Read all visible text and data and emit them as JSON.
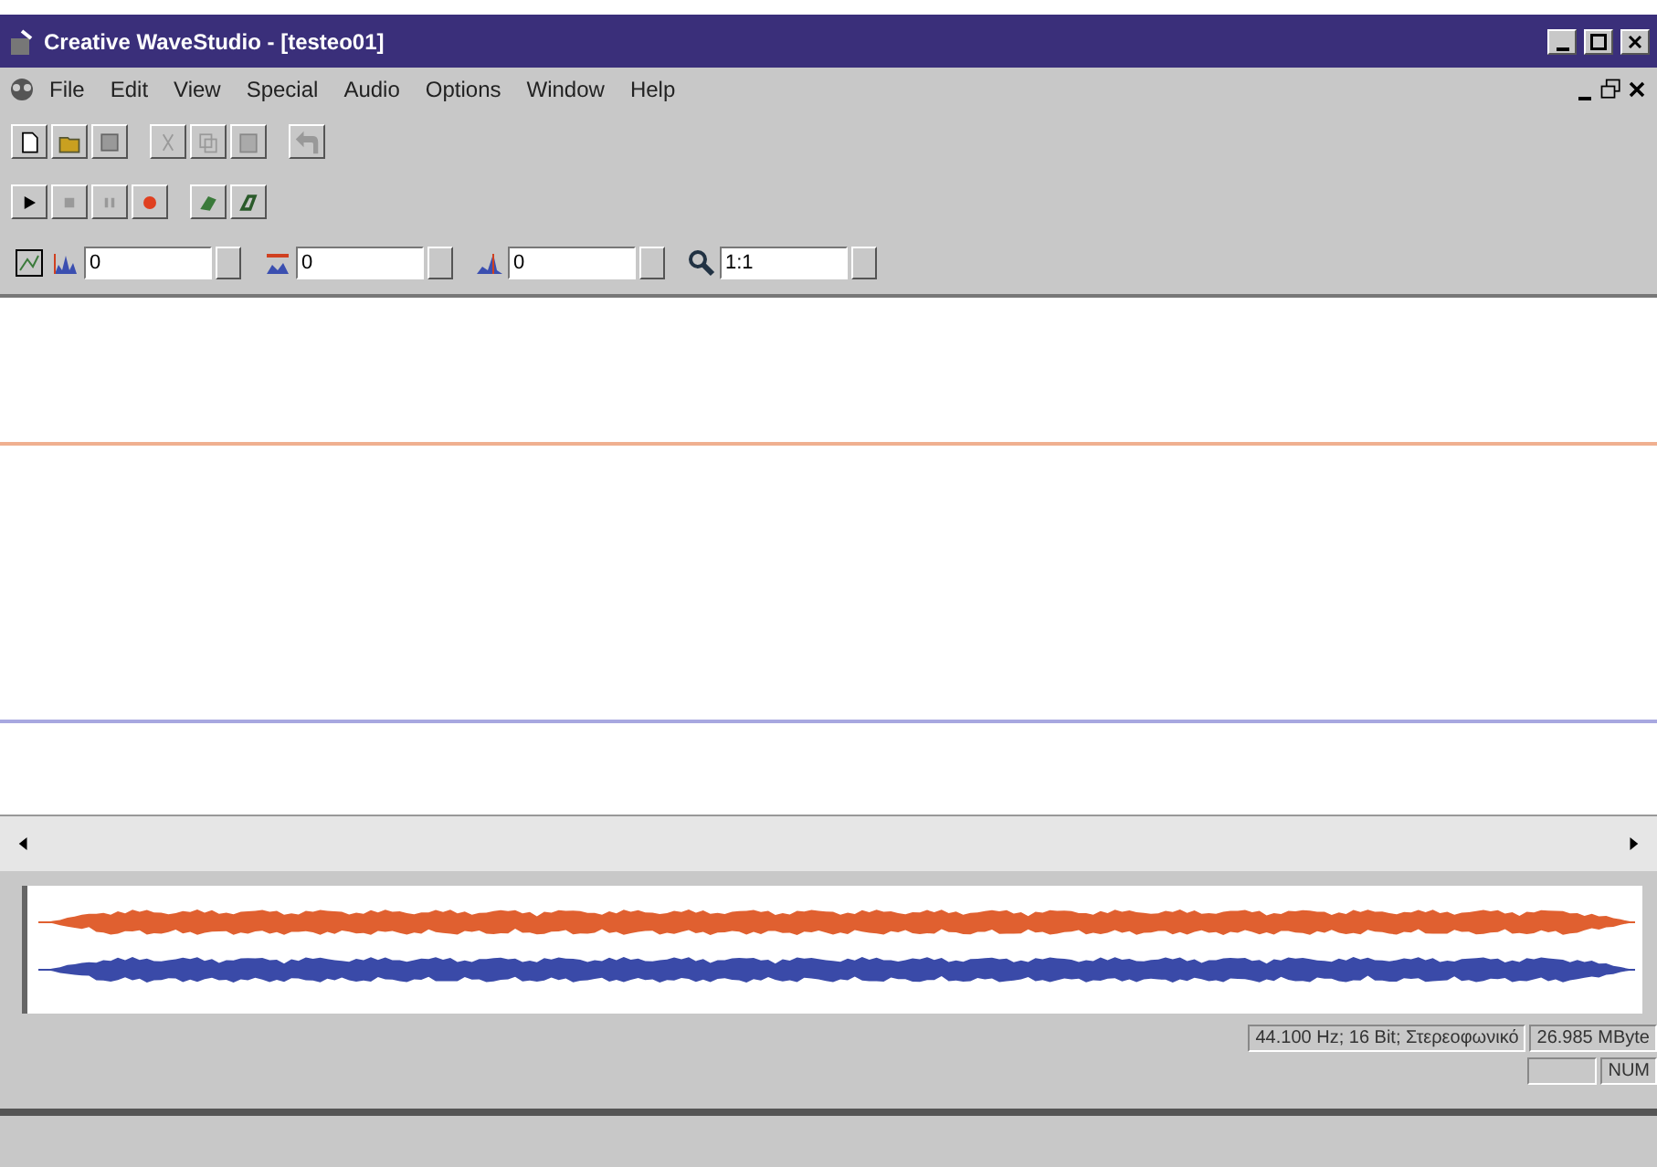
{
  "window": {
    "title": "Creative WaveStudio - [testeo01]"
  },
  "menu": [
    "File",
    "Edit",
    "View",
    "Special",
    "Audio",
    "Options",
    "Window",
    "Help"
  ],
  "spin_fields": [
    {
      "value": "0"
    },
    {
      "value": "0"
    },
    {
      "value": "0"
    },
    {
      "value": "1:1"
    }
  ],
  "status_bar": {
    "format": "44.100 Hz; 16 Bit; Στερεοφωνικό",
    "size": "26.985 MByte",
    "indicator": "NUM"
  }
}
